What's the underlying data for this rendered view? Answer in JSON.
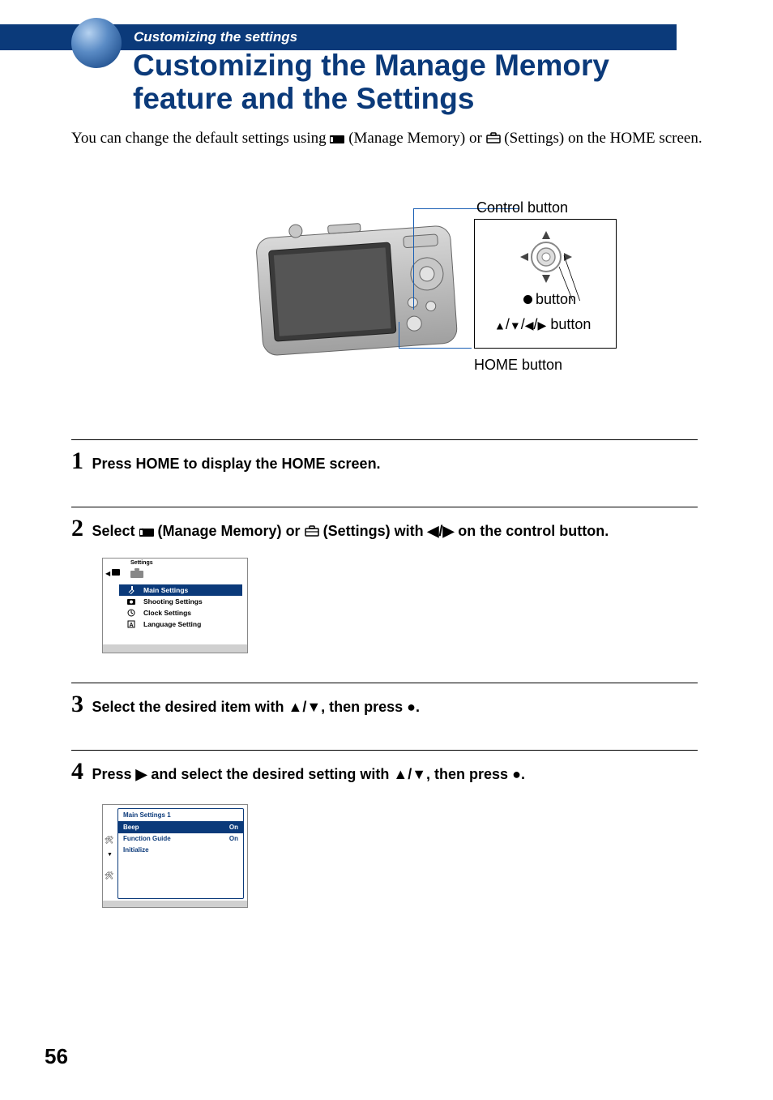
{
  "header": {
    "section_label": "Customizing the settings",
    "title": "Customizing the Manage Memory feature and the Settings"
  },
  "intro": {
    "part1": "You can change the default settings using ",
    "icon1_label": "(Manage Memory)",
    "or": " or ",
    "icon2_label": "(Settings)",
    "part2": " on the HOME screen."
  },
  "figure": {
    "control_button_label": "Control button",
    "center_button_label": "button",
    "direction_button_label": "button",
    "home_button_label": "HOME button"
  },
  "steps": [
    {
      "num": "1",
      "text": "Press HOME to display the HOME screen."
    },
    {
      "num": "2",
      "text_a": "Select ",
      "icon1_label": "(Manage Memory)",
      "text_b": " or ",
      "icon2_label": "(Settings)",
      "text_c": " with ◀/▶ on the control button."
    },
    {
      "num": "3",
      "text": "Select the desired item with ▲/▼, then press ●."
    },
    {
      "num": "4",
      "text": "Press ▶ and select the desired setting with ▲/▼, then press ●."
    }
  ],
  "screen1": {
    "heading": "Settings",
    "rows": [
      {
        "label": "Main Settings",
        "selected": true,
        "icon": "tool"
      },
      {
        "label": "Shooting Settings",
        "selected": false,
        "icon": "camera"
      },
      {
        "label": "Clock Settings",
        "selected": false,
        "icon": "clock"
      },
      {
        "label": "Language Setting",
        "selected": false,
        "icon": "lang"
      }
    ]
  },
  "screen2": {
    "title": "Main Settings 1",
    "rows": [
      {
        "label": "Beep",
        "value": "On",
        "selected": true
      },
      {
        "label": "Function Guide",
        "value": "On",
        "selected": false
      },
      {
        "label": "Initialize",
        "value": "",
        "selected": false
      }
    ]
  },
  "page_number": "56"
}
